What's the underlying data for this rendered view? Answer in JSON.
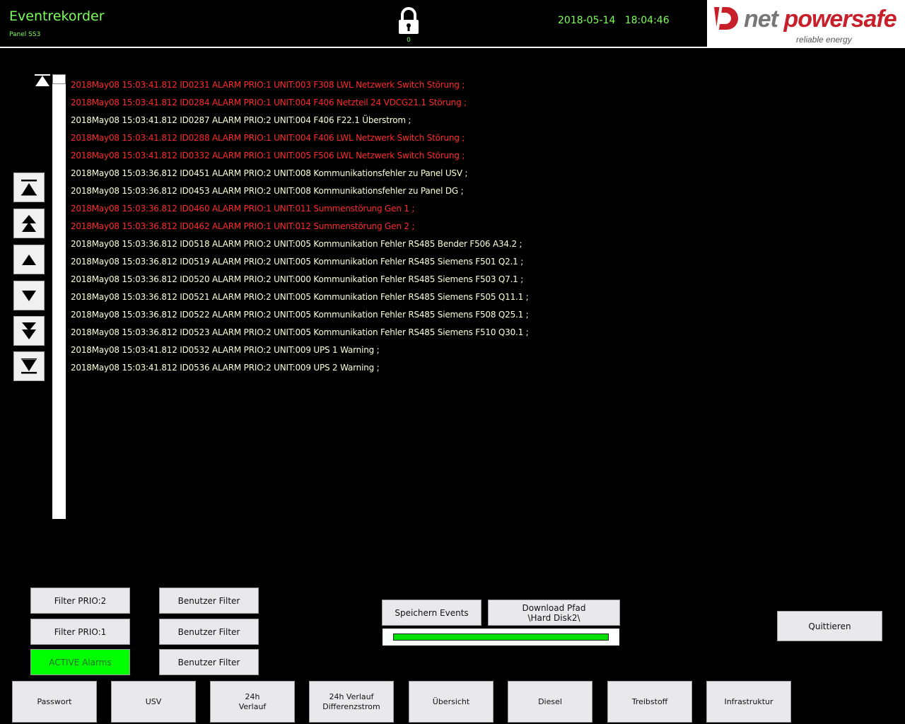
{
  "header": {
    "title": "Eventrekorder",
    "panel": "Panel SS3",
    "lock_count": "0",
    "date": "2018-05-14",
    "time": "18:04:46",
    "logo_part1": "net",
    "logo_part2": "powersafe",
    "logo_tagline": "reliable energy"
  },
  "colors": {
    "accent_green": "#7dff5a",
    "alarm_red": "#ff2a2a",
    "alarm_normal": "#ffffd8",
    "active_green": "#00ff00"
  },
  "events": [
    {
      "text": "2018May08 15:03:41.812 ID0231 ALARM PRIO:1 UNIT:003 F308 LWL Netzwerk Switch Störung ;",
      "prio": 1
    },
    {
      "text": "2018May08 15:03:41.812 ID0284 ALARM PRIO:1 UNIT:004 F406 Netzteil 24 VDCG21.1 Störung ;",
      "prio": 1
    },
    {
      "text": "2018May08 15:03:41.812 ID0287 ALARM PRIO:2 UNIT:004 F406 F22.1 Überstrom ;",
      "prio": 2
    },
    {
      "text": "2018May08 15:03:41.812 ID0288 ALARM PRIO:1 UNIT:004 F406 LWL Netzwerk Switch Störung ;",
      "prio": 1
    },
    {
      "text": "2018May08 15:03:41.812 ID0332 ALARM PRIO:1 UNIT:005 F506 LWL Netzwerk Switch Störung ;",
      "prio": 1
    },
    {
      "text": "2018May08 15:03:36.812 ID0451 ALARM PRIO:2 UNIT:008 Kommunikationsfehler zu Panel USV ;",
      "prio": 2
    },
    {
      "text": "2018May08 15:03:36.812 ID0453 ALARM PRIO:2 UNIT:008 Kommunikationsfehler zu Panel DG ;",
      "prio": 2
    },
    {
      "text": "2018May08 15:03:36.812 ID0460 ALARM PRIO:1 UNIT:011 Summenstörung Gen 1 ;",
      "prio": 1
    },
    {
      "text": "2018May08 15:03:36.812 ID0462 ALARM PRIO:1 UNIT:012 Summenstörung Gen 2 ;",
      "prio": 1
    },
    {
      "text": "2018May08 15:03:36.812 ID0518 ALARM PRIO:2 UNIT:005 Kommunikation Fehler RS485 Bender F506 A34.2 ;",
      "prio": 2
    },
    {
      "text": "2018May08 15:03:36.812 ID0519 ALARM PRIO:2 UNIT:005 Kommunikation Fehler RS485 Siemens F501 Q2.1 ;",
      "prio": 2
    },
    {
      "text": "2018May08 15:03:36.812 ID0520 ALARM PRIO:2 UNIT:000 Kommunikation Fehler RS485 Siemens F503 Q7.1 ;",
      "prio": 2
    },
    {
      "text": "2018May08 15:03:36.812 ID0521 ALARM PRIO:2 UNIT:005 Kommunikation Fehler RS485 Siemens F505 Q11.1 ;",
      "prio": 2
    },
    {
      "text": "2018May08 15:03:36.812 ID0522 ALARM PRIO:2 UNIT:005 Kommunikation Fehler RS485 Siemens F508 Q25.1 ;",
      "prio": 2
    },
    {
      "text": "2018May08 15:03:36.812 ID0523 ALARM PRIO:2 UNIT:005 Kommunikation Fehler RS485 Siemens F510 Q30.1 ;",
      "prio": 2
    },
    {
      "text": "2018May08 15:03:41.812 ID0532 ALARM PRIO:2 UNIT:009 UPS 1 Warning ;",
      "prio": 2
    },
    {
      "text": "2018May08 15:03:41.812 ID0536 ALARM PRIO:2 UNIT:009 UPS 2 Warning ;",
      "prio": 2
    }
  ],
  "nav_icons": [
    "scroll-first-icon",
    "page-up-icon",
    "line-up-icon",
    "line-down-icon",
    "page-down-icon",
    "scroll-last-icon"
  ],
  "filters": {
    "prio2": "Filter PRIO:2",
    "prio1": "Filter PRIO:1",
    "active": "ACTIVE Alarms",
    "user1": "Benutzer Filter",
    "user2": "Benutzer Filter",
    "user3": "Benutzer Filter"
  },
  "actions": {
    "save_events": "Speichern Events",
    "download_line1": "Download Pfad",
    "download_line2": "\\Hard Disk2\\",
    "progress": 1.0,
    "acknowledge": "Quittieren"
  },
  "bottom_nav": [
    {
      "line1": "Passwort",
      "line2": ""
    },
    {
      "line1": "USV",
      "line2": ""
    },
    {
      "line1": "24h",
      "line2": "Verlauf"
    },
    {
      "line1": "24h Verlauf",
      "line2": "Differenzstrom"
    },
    {
      "line1": "Übersicht",
      "line2": ""
    },
    {
      "line1": "Diesel",
      "line2": ""
    },
    {
      "line1": "Treibstoff",
      "line2": ""
    },
    {
      "line1": "Infrastruktur",
      "line2": ""
    }
  ]
}
